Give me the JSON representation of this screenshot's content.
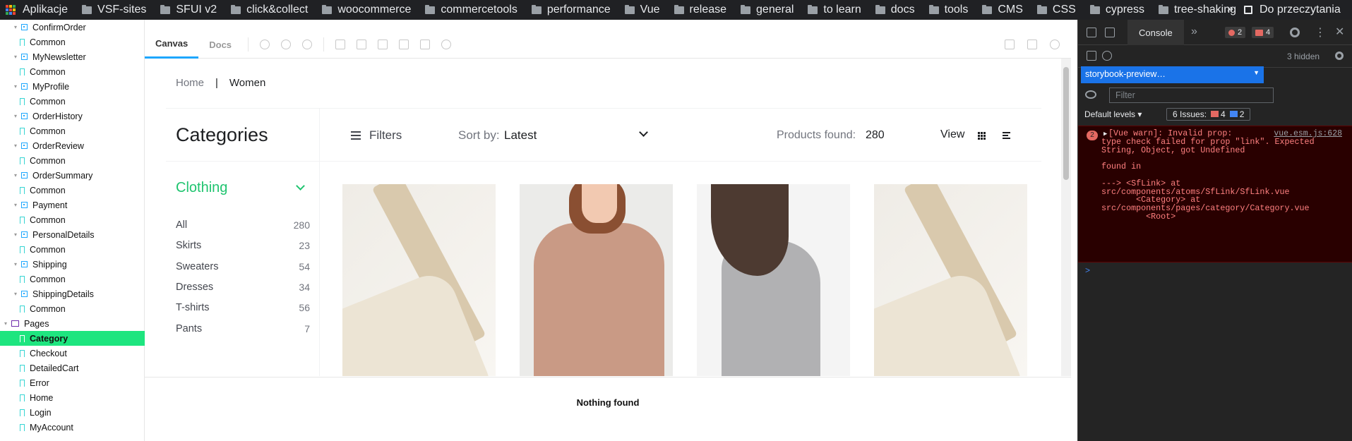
{
  "bookmarks": {
    "apps": "Aplikacje",
    "items": [
      "VSF-sites",
      "SFUI v2",
      "click&collect",
      "woocommerce",
      "commercetools",
      "performance",
      "Vue",
      "release",
      "general",
      "to learn",
      "docs",
      "tools",
      "CMS",
      "CSS",
      "cypress",
      "tree-shaking"
    ],
    "more": "»",
    "reading_list": "Do przeczytania"
  },
  "sidebar": {
    "rows": [
      {
        "label": "ConfirmOrder",
        "kind": "component"
      },
      {
        "label": "Common",
        "kind": "story"
      },
      {
        "label": "MyNewsletter",
        "kind": "component"
      },
      {
        "label": "Common",
        "kind": "story"
      },
      {
        "label": "MyProfile",
        "kind": "component"
      },
      {
        "label": "Common",
        "kind": "story"
      },
      {
        "label": "OrderHistory",
        "kind": "component"
      },
      {
        "label": "Common",
        "kind": "story"
      },
      {
        "label": "OrderReview",
        "kind": "component"
      },
      {
        "label": "Common",
        "kind": "story"
      },
      {
        "label": "OrderSummary",
        "kind": "component"
      },
      {
        "label": "Common",
        "kind": "story"
      },
      {
        "label": "Payment",
        "kind": "component"
      },
      {
        "label": "Common",
        "kind": "story"
      },
      {
        "label": "PersonalDetails",
        "kind": "component"
      },
      {
        "label": "Common",
        "kind": "story"
      },
      {
        "label": "Shipping",
        "kind": "component"
      },
      {
        "label": "Common",
        "kind": "story"
      },
      {
        "label": "ShippingDetails",
        "kind": "component"
      },
      {
        "label": "Common",
        "kind": "story"
      },
      {
        "label": "Pages",
        "kind": "folder"
      },
      {
        "label": "Category",
        "kind": "page"
      },
      {
        "label": "Checkout",
        "kind": "page"
      },
      {
        "label": "DetailedCart",
        "kind": "page"
      },
      {
        "label": "Error",
        "kind": "page"
      },
      {
        "label": "Home",
        "kind": "page"
      },
      {
        "label": "Login",
        "kind": "page"
      },
      {
        "label": "MyAccount",
        "kind": "page"
      }
    ],
    "selected_label": "Category"
  },
  "toolbar": {
    "tab_canvas": "Canvas",
    "tab_docs": "Docs"
  },
  "preview": {
    "breadcrumb_home": "Home",
    "breadcrumb_sep": "|",
    "breadcrumb_current": "Women",
    "categories_title": "Categories",
    "filters_label": "Filters",
    "sort_label": "Sort by:",
    "sort_value": "Latest",
    "products_found_label": "Products found:",
    "products_found_value": "280",
    "view_label": "View",
    "active_category": "Clothing",
    "categories": [
      {
        "name": "All",
        "count": "280"
      },
      {
        "name": "Skirts",
        "count": "23"
      },
      {
        "name": "Sweaters",
        "count": "54"
      },
      {
        "name": "Dresses",
        "count": "34"
      },
      {
        "name": "T-shirts",
        "count": "56"
      },
      {
        "name": "Pants",
        "count": "7"
      }
    ],
    "nothing_found": "Nothing found"
  },
  "devtools": {
    "tab_console": "Console",
    "more_tabs": "»",
    "error_badge": "2",
    "issue_badge": "4",
    "hidden_label": "3 hidden",
    "context": "storybook-preview…",
    "filter_placeholder": "Filter",
    "levels": "Default levels ▾",
    "issues_label": "6 Issues:",
    "issues_errors": "4",
    "issues_info": "2",
    "error_count": "2",
    "error_source": "vue.esm.js:628",
    "error_lines": [
      "[Vue warn]: Invalid prop:",
      "type check failed for prop \"link\". Expected",
      "String, Object, got Undefined",
      "",
      "found in",
      "",
      "---> <SfLink> at",
      "src/components/atoms/SfLink/SfLink.vue",
      "       <Category> at",
      "src/components/pages/category/Category.vue",
      "         <Root>"
    ],
    "prompt": ">"
  },
  "colors": {
    "accent_green": "#1fc46f",
    "selected_row": "#1ee57f",
    "devtools_bg": "#242424",
    "error_bg": "#290000",
    "error_text": "#ff8080"
  }
}
